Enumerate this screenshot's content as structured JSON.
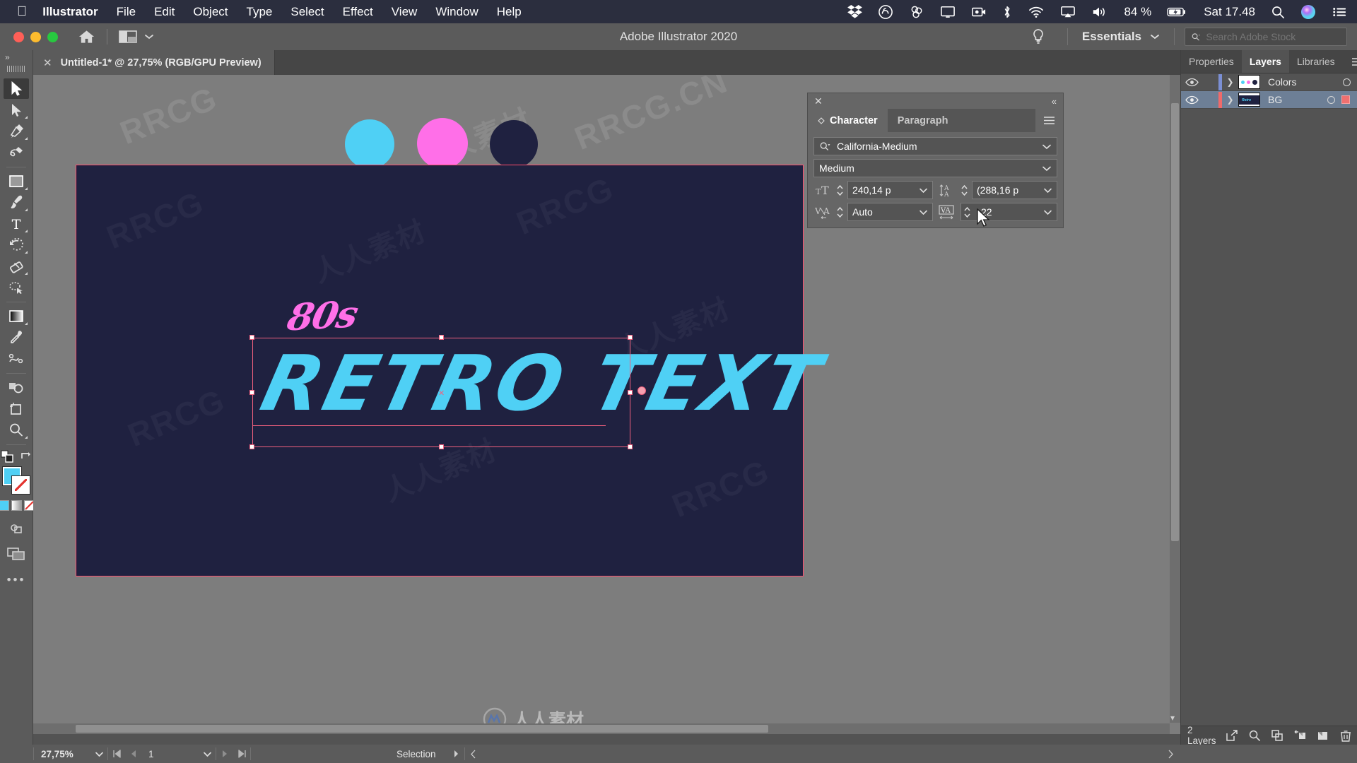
{
  "menubar": {
    "apple_icon": "apple-icon",
    "app_name": "Illustrator",
    "items": [
      "File",
      "Edit",
      "Object",
      "Type",
      "Select",
      "Effect",
      "View",
      "Window",
      "Help"
    ],
    "status_icons": [
      "dropbox-icon",
      "creative-cloud-icon",
      "adobe-app-icon",
      "display-icon",
      "screen-record-icon",
      "bluetooth-icon",
      "wifi-icon",
      "airplay-icon",
      "volume-icon"
    ],
    "battery": "84 %",
    "battery_icon": "battery-charging-icon",
    "clock": "Sat 17.48",
    "search_icon": "spotlight-search-icon",
    "siri_icon": "siri-icon",
    "control_center_icon": "control-center-icon"
  },
  "titlebar": {
    "window_title": "Adobe Illustrator 2020",
    "home_icon": "home-icon",
    "arrange_icon": "arrange-documents-icon",
    "arrange_chevron": "chevron-down-icon",
    "bulb_icon": "discover-bulb-icon",
    "workspace": "Essentials",
    "workspace_chevron": "chevron-down-icon",
    "search": {
      "icon": "search-icon",
      "placeholder": "Search Adobe Stock",
      "value": ""
    }
  },
  "tabbar": {
    "close_icon": "close-icon",
    "tab_title": "Untitled-1* @ 27,75% (RGB/GPU Preview)"
  },
  "toolbar": {
    "expand_icon": "expand-toolbar-icon",
    "tools": [
      {
        "name": "selection-tool",
        "glyph": "selection-arrow-icon",
        "active": true,
        "has_flyout": false
      },
      {
        "name": "direct-selection-tool",
        "glyph": "direct-selection-icon",
        "active": false,
        "has_flyout": true
      },
      {
        "name": "pen-tool",
        "glyph": "pen-icon",
        "active": false,
        "has_flyout": true
      },
      {
        "name": "curvature-tool",
        "glyph": "curvature-icon",
        "active": false,
        "has_flyout": false
      },
      {
        "name": "rectangle-tool",
        "glyph": "rectangle-icon",
        "active": false,
        "has_flyout": true
      },
      {
        "name": "paintbrush-tool",
        "glyph": "paintbrush-icon",
        "active": false,
        "has_flyout": true
      },
      {
        "name": "type-tool",
        "glyph": "type-icon",
        "active": false,
        "has_flyout": true
      },
      {
        "name": "rotate-tool",
        "glyph": "rotate-icon",
        "active": false,
        "has_flyout": true
      },
      {
        "name": "eraser-tool",
        "glyph": "eraser-icon",
        "active": false,
        "has_flyout": true
      },
      {
        "name": "lasso-tool",
        "glyph": "lasso-icon",
        "active": false,
        "has_flyout": false
      },
      {
        "name": "gradient-tool",
        "glyph": "gradient-icon",
        "active": false,
        "has_flyout": true
      },
      {
        "name": "eyedropper-tool",
        "glyph": "eyedropper-icon",
        "active": false,
        "has_flyout": false
      },
      {
        "name": "blend-tool",
        "glyph": "blend-icon",
        "active": false,
        "has_flyout": false
      },
      {
        "name": "shape-builder-tool",
        "glyph": "shape-builder-icon",
        "active": false,
        "has_flyout": false
      },
      {
        "name": "artboard-tool",
        "glyph": "artboard-icon",
        "active": false,
        "has_flyout": false
      },
      {
        "name": "zoom-tool",
        "glyph": "magnifier-icon",
        "active": false,
        "has_flyout": true
      }
    ],
    "swap_icon": "swap-fill-stroke-icon",
    "default_icon": "default-fill-stroke-icon",
    "fill_color": "#4FD0F5",
    "stroke_color": "#FFFFFF",
    "stroke_none": true,
    "mini_color": "#4FD0F5",
    "draw_mode_icon": "draw-normal-icon",
    "screen_mode_icon": "screen-mode-icon",
    "more_icon": "edit-toolbar-icon"
  },
  "canvas": {
    "zoom": "27,75%",
    "artboard_bg": "#1F2140",
    "artboard_border": "#ff4d6d",
    "circles": [
      {
        "name": "swatch-circle-cyan",
        "color": "#4FD0F5"
      },
      {
        "name": "swatch-circle-pink",
        "color": "#FF6FE8"
      },
      {
        "name": "swatch-circle-navy",
        "color": "#1F2140"
      }
    ],
    "artwork": {
      "accent_text": "80s",
      "accent_color": "#FF6FE8",
      "main_text": "RETRO TEXT",
      "main_color": "#4FD0F5"
    },
    "watermarks": [
      "RRCG",
      "人人素材",
      "RRCG.CN"
    ],
    "brand_mark": "人人素材"
  },
  "character_panel": {
    "close_icon": "close-icon",
    "collapse_icon": "collapse-panel-icon",
    "menu_icon": "panel-menu-icon",
    "tabs": [
      {
        "label": "Character",
        "active": true
      },
      {
        "label": "Paragraph",
        "active": false
      }
    ],
    "font_family": {
      "icon": "font-search-icon",
      "value": "California-Medium",
      "chevron": "chevron-down-icon"
    },
    "font_style": {
      "value": "Medium",
      "chevron": "chevron-down-icon"
    },
    "font_size": {
      "icon": "font-size-icon",
      "value": "240,14 p",
      "stepper": "stepper-icon",
      "chevron": "chevron-down-icon"
    },
    "leading": {
      "icon": "leading-icon",
      "value": "(288,16 p",
      "stepper": "stepper-icon",
      "chevron": "chevron-down-icon"
    },
    "kerning": {
      "icon": "kerning-icon",
      "value": "Auto",
      "stepper": "stepper-icon",
      "chevron": "chevron-down-icon"
    },
    "tracking": {
      "icon": "tracking-icon",
      "value": "22",
      "stepper": "stepper-icon",
      "chevron": "chevron-down-icon"
    }
  },
  "right_dock": {
    "collapse_icon": "collapse-dock-icon",
    "tabs": [
      {
        "label": "Properties",
        "active": false
      },
      {
        "label": "Layers",
        "active": true
      },
      {
        "label": "Libraries",
        "active": false
      }
    ],
    "menu_icon": "panel-menu-icon",
    "layers": [
      {
        "name": "Colors",
        "visible": true,
        "visibility_icon": "eye-icon",
        "color": "#7b8fd4",
        "expand_icon": "chevron-right-icon",
        "selected": false,
        "target_icon": "target-circle-icon",
        "has_selection_square": false
      },
      {
        "name": "BG",
        "visible": true,
        "visibility_icon": "eye-icon",
        "color": "#f06a6a",
        "expand_icon": "chevron-right-icon",
        "selected": true,
        "target_icon": "target-circle-icon",
        "has_selection_square": true,
        "selection_color": "#f07070"
      }
    ],
    "footer": {
      "count_label": "2 Layers",
      "icons": [
        "release-to-layers-icon",
        "locate-object-icon",
        "make-clipping-mask-icon",
        "create-new-sublayer-icon",
        "create-new-layer-icon",
        "delete-layer-icon"
      ]
    }
  },
  "statusbar": {
    "zoom": "27,75%",
    "zoom_chevron": "chevron-down-icon",
    "nav_first_icon": "first-artboard-icon",
    "nav_prev_icon": "prev-artboard-icon",
    "page": "1",
    "page_chevron": "chevron-down-icon",
    "nav_next_icon": "next-artboard-icon",
    "nav_last_icon": "last-artboard-icon",
    "current_tool": "Selection",
    "tool_chevron": "chevron-right-icon",
    "scroll_left_icon": "scroll-left-icon",
    "scroll_right_icon": "scroll-right-icon"
  }
}
